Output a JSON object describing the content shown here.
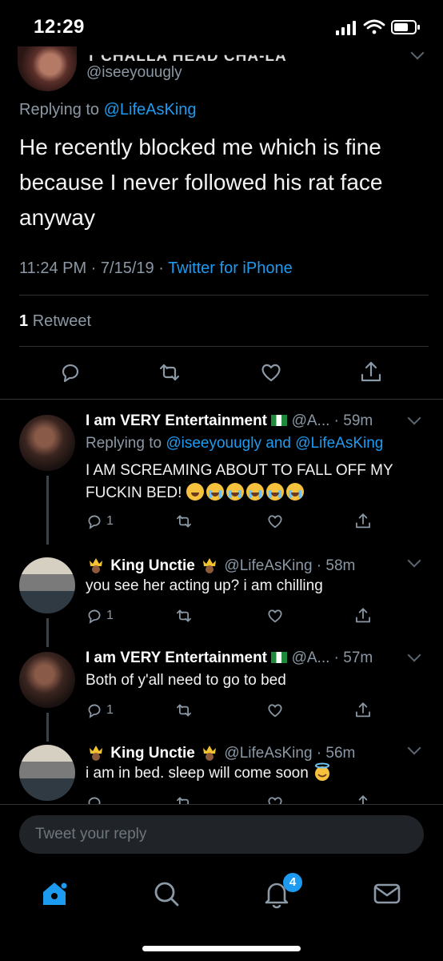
{
  "status_bar": {
    "time": "12:29"
  },
  "main_tweet": {
    "display_name": "T'CHALLA HEAD CHA-LA",
    "handle": "@iseeyouugly",
    "replying_prefix": "Replying to",
    "replying_to": "@LifeAsKing",
    "text": "He recently blocked me which is fine because I never followed his rat face anyway",
    "time": "11:24 PM",
    "date": "7/15/19",
    "client": "Twitter for iPhone",
    "retweet_count": "1",
    "retweet_label": "Retweet"
  },
  "replies": [
    {
      "name": "I am VERY Entertainment",
      "meta": "@A... · 59m",
      "replying_prefix": "Replying to",
      "replying_user1": "@iseeyouugly",
      "replying_and": "and",
      "replying_user2": "@LifeAsKing",
      "text": "I AM SCREAMING ABOUT TO FALL OFF MY FUCKIN BED!",
      "reply_count": "1"
    },
    {
      "name": "King Unctie",
      "meta": "@LifeAsKing · 58m",
      "text": "you see her acting up? i am chilling",
      "reply_count": "1"
    },
    {
      "name": "I am VERY Entertainment",
      "meta": "@A... · 57m",
      "text": "Both of y'all need to go to bed",
      "reply_count": "1"
    },
    {
      "name": "King Unctie",
      "meta": "@LifeAsKing · 56m",
      "text": "i am in bed. sleep will come soon"
    }
  ],
  "compose": {
    "placeholder": "Tweet your reply"
  },
  "tabbar": {
    "notification_badge": "4"
  },
  "colors": {
    "accent": "#1d9bf0",
    "background": "#000000",
    "secondary_text": "#8b98a5"
  }
}
